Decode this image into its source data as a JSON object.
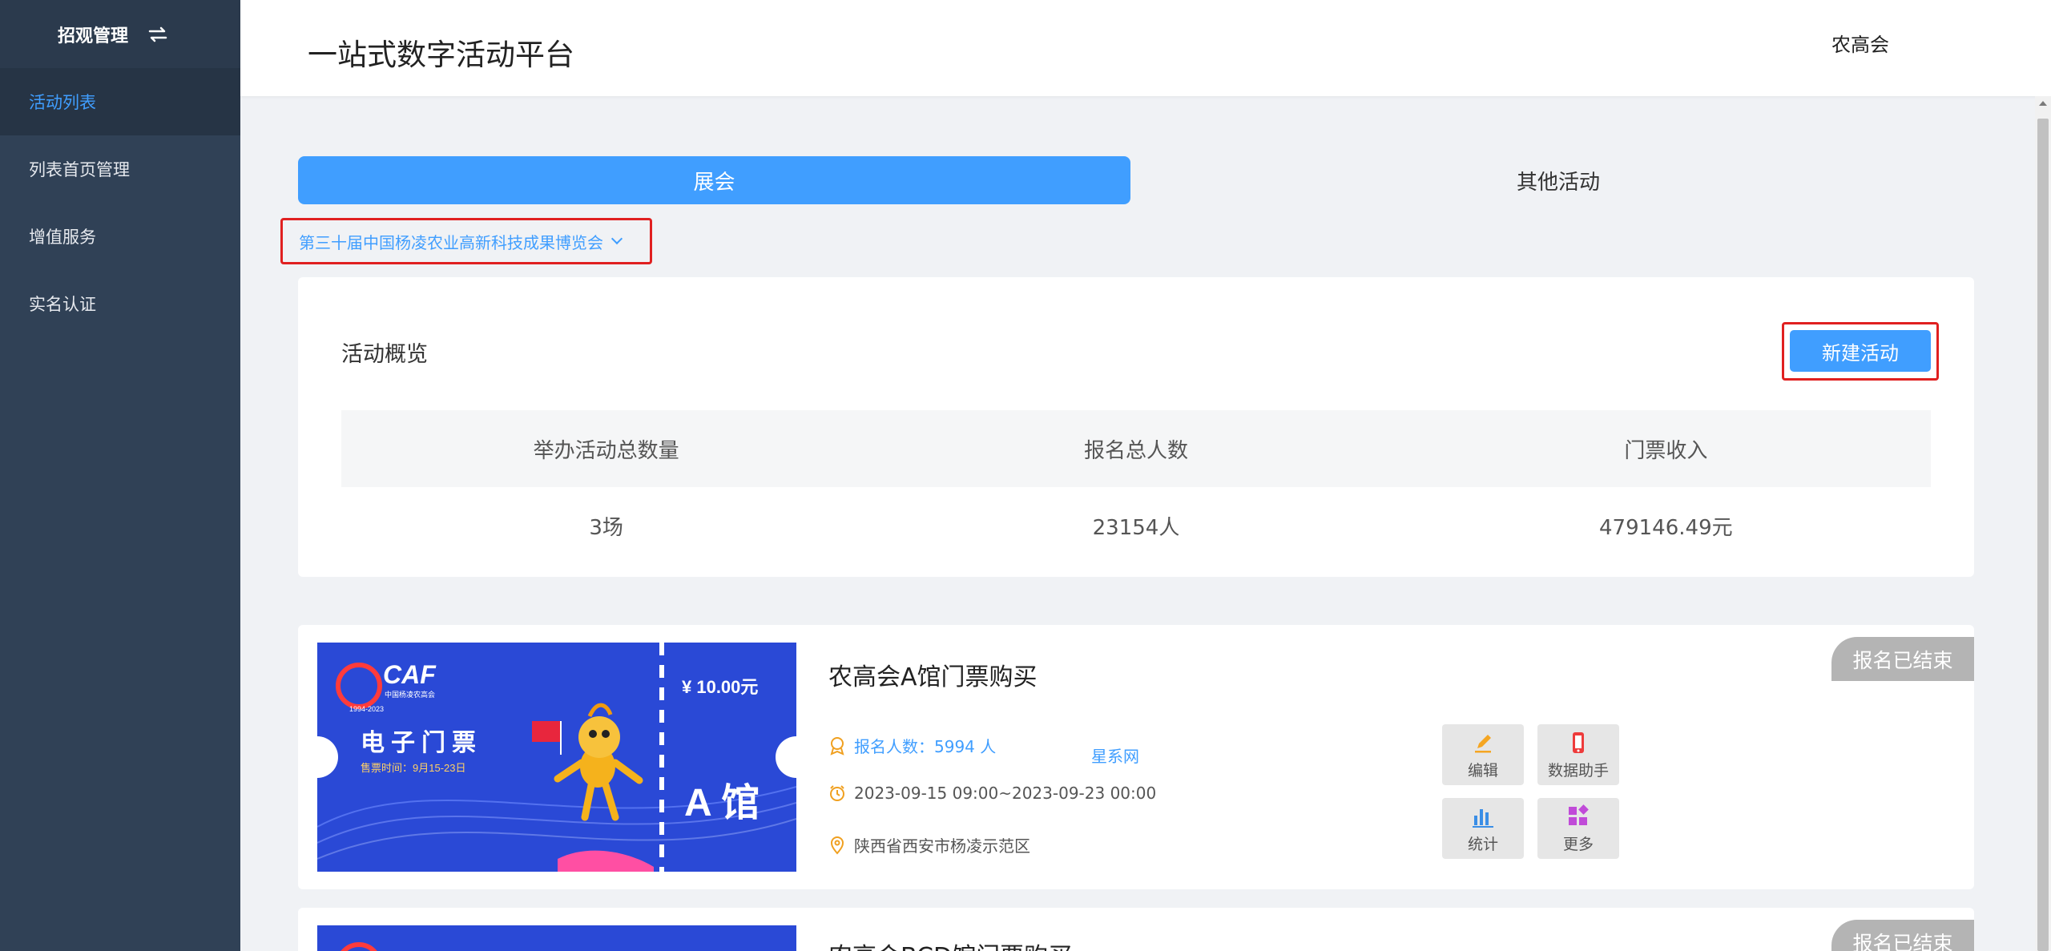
{
  "sidebar": {
    "title": "招观管理",
    "items": [
      {
        "label": "活动列表",
        "active": true
      },
      {
        "label": "列表首页管理",
        "active": false
      },
      {
        "label": "增值服务",
        "active": false
      },
      {
        "label": "实名认证",
        "active": false
      }
    ]
  },
  "header": {
    "title": "一站式数字活动平台",
    "user": "农高会"
  },
  "tabs": [
    {
      "label": "展会",
      "active": true
    },
    {
      "label": "其他活动",
      "active": false
    }
  ],
  "expo_selector": {
    "value": "第三十届中国杨凌农业高新科技成果博览会"
  },
  "overview": {
    "title": "活动概览",
    "new_button": "新建活动",
    "headers": [
      "举办活动总数量",
      "报名总人数",
      "门票收入"
    ],
    "values": [
      "3场",
      "23154人",
      "479146.49元"
    ]
  },
  "activities": [
    {
      "title": "农高会A馆门票购买",
      "status": "报名已结束",
      "signup": "报名人数：5994 人",
      "site": "星系网",
      "time": "2023-09-15 09:00~2023-09-23 00:00",
      "location": "陕西省西安市杨凌示范区",
      "ticket": {
        "caf": "CAF",
        "caf_sub": "中国杨凌农高会",
        "years": "1994-2023",
        "label": "电子门票",
        "date": "售票时间：9月15-23日",
        "price": "¥ 10.00元",
        "hall": "A 馆"
      },
      "actions": [
        "编辑",
        "数据助手",
        "统计",
        "更多"
      ]
    },
    {
      "title": "农高会BCD馆门票购买",
      "status": "报名已结束"
    }
  ],
  "colors": {
    "primary": "#409eff",
    "sidebar_bg": "#304156",
    "highlight_frame": "#e02020",
    "status_gray": "#b4b4b4",
    "ticket_blue": "#2a49d6"
  }
}
